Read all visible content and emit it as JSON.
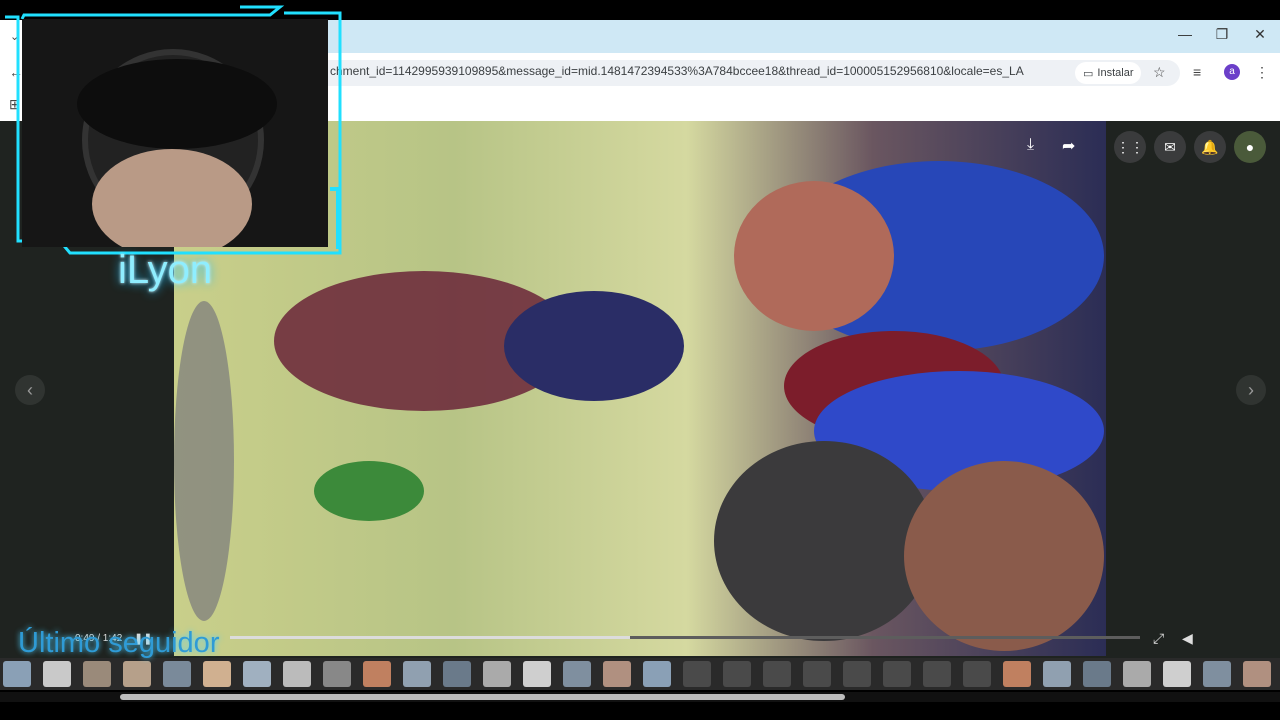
{
  "browser": {
    "url": "chment_id=1142995939109895&message_id=mid.1481472394533%3A784bccee18&thread_id=100005152956810&locale=es_LA",
    "install_label": "Instalar",
    "avatar_letter": "a"
  },
  "player": {
    "time": "0:49 / 1:42",
    "progress": 0.44
  },
  "overlay": {
    "streamer_name": "iLyon",
    "last_follower_label": "Último seguidor"
  },
  "icons": {
    "download": "download-icon",
    "share": "share-icon",
    "apps": "apps-grid-icon",
    "messenger": "messenger-icon",
    "notifications": "bell-icon",
    "expand": "expand-icon",
    "volume": "volume-icon"
  },
  "colors": {
    "accent": "#21e0ff",
    "titlebar": "#cfe8f5",
    "viewer_bg": "#1f2320"
  }
}
